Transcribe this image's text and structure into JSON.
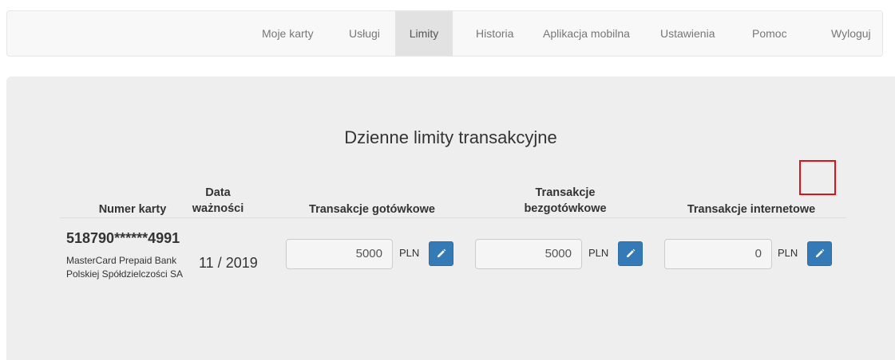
{
  "nav": {
    "items": [
      {
        "label": "Moje karty"
      },
      {
        "label": "Usługi"
      },
      {
        "label": "Limity"
      },
      {
        "label": "Historia"
      },
      {
        "label": "Aplikacja mobilna"
      },
      {
        "label": "Ustawienia"
      },
      {
        "label": "Pomoc"
      },
      {
        "label": "Wyloguj"
      }
    ],
    "active": "Limity"
  },
  "page": {
    "title": "Dzienne limity transakcyjne"
  },
  "table": {
    "headers": {
      "card_number": "Numer karty",
      "expiry_line1": "Data",
      "expiry_line2": "ważności",
      "cash": "Transakcje gotówkowe",
      "cashless_line1": "Transakcje",
      "cashless_line2": "bezgotówkowe",
      "internet": "Transakcje internetowe"
    },
    "rows": [
      {
        "card_number": "518790******4991",
        "card_desc": "MasterCard Prepaid Bank Polskiej Spółdzielczości SA",
        "expiry": "11 / 2019",
        "cash_limit": "5000",
        "cashless_limit": "5000",
        "internet_limit": "0",
        "currency": "PLN"
      }
    ]
  },
  "icons": {
    "edit": "pencil-icon"
  },
  "colors": {
    "edit_button": "#337ab7",
    "highlight": "#e0101b",
    "panel": "#eeeeee"
  }
}
